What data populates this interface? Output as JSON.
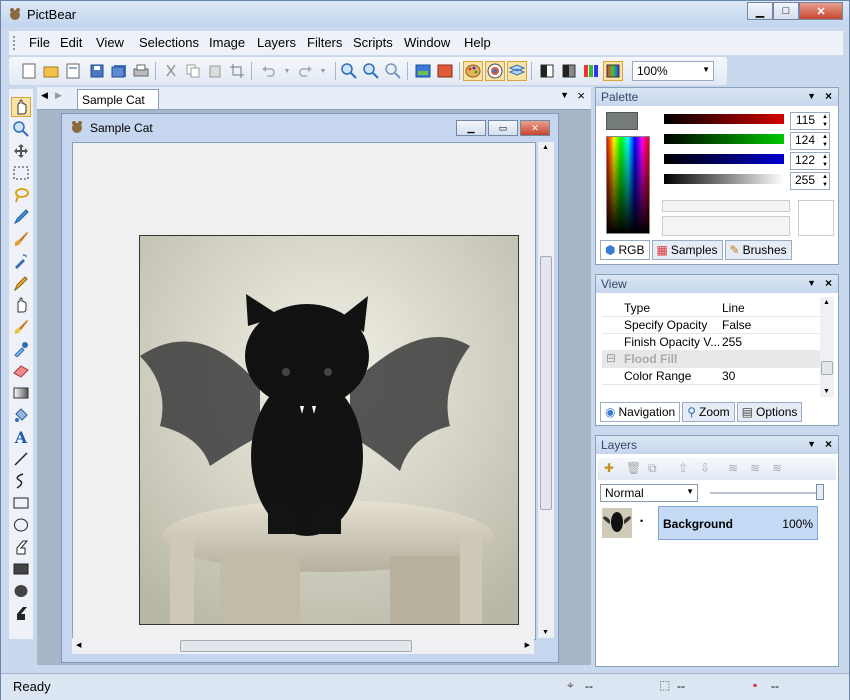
{
  "app": {
    "title": "PictBear"
  },
  "menu": [
    "File",
    "Edit",
    "View",
    "Selections",
    "Image",
    "Layers",
    "Filters",
    "Scripts",
    "Window",
    "Help"
  ],
  "toolbar": {
    "zoom": "100%"
  },
  "document": {
    "tab_label": "Sample Cat",
    "window_title": "Sample Cat"
  },
  "palette": {
    "title": "Palette",
    "r": "115",
    "g": "124",
    "b": "122",
    "a": "255",
    "tabs": [
      "RGB",
      "Samples",
      "Brushes"
    ],
    "colors": {
      "fg": "#737c7a",
      "red": "#d40000",
      "green": "#00c800",
      "blue": "#0000d0"
    }
  },
  "view_panel": {
    "title": "View",
    "rows": [
      {
        "key": "Type",
        "value": "Line"
      },
      {
        "key": "Specify Opacity",
        "value": "False"
      },
      {
        "key": "Finish Opacity V...",
        "value": "255"
      },
      {
        "key": "Flood Fill",
        "value": ""
      },
      {
        "key": "Color Range",
        "value": "30"
      }
    ],
    "tabs": [
      "Navigation",
      "Zoom",
      "Options"
    ]
  },
  "layers": {
    "title": "Layers",
    "blend_mode": "Normal",
    "items": [
      {
        "name": "Background",
        "opacity": "100%"
      }
    ]
  },
  "status": {
    "message": "Ready",
    "coord1": "--",
    "coord2": "--",
    "coord3": "--"
  }
}
